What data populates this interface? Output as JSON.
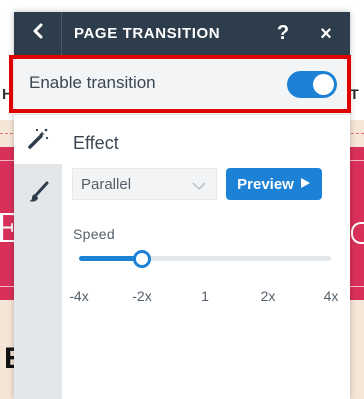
{
  "background": {
    "nav_left_text": "H",
    "nav_right_text": "RT",
    "hero_letter": "E",
    "section_letter": "E"
  },
  "panel": {
    "title": "PAGE TRANSITION",
    "help_label": "?",
    "close_label": "×",
    "back_icon": "chevron-left-icon"
  },
  "enable": {
    "label": "Enable transition",
    "enabled": true
  },
  "rail": {
    "items": [
      {
        "name": "effect",
        "icon": "magic-wand-icon",
        "active": true
      },
      {
        "name": "style",
        "icon": "paintbrush-icon",
        "active": false
      }
    ]
  },
  "effect": {
    "title": "Effect",
    "selected": "Parallel",
    "preview_label": "Preview",
    "speed_label": "Speed",
    "speed_ticks": [
      "-4x",
      "-2x",
      "1",
      "2x",
      "4x"
    ],
    "speed_value": "-2x",
    "speed_position": 0.25
  },
  "colors": {
    "header": "#2e3d4c",
    "accent": "#1d82d6",
    "highlight": "#e00000",
    "hero": "#d9305a"
  }
}
